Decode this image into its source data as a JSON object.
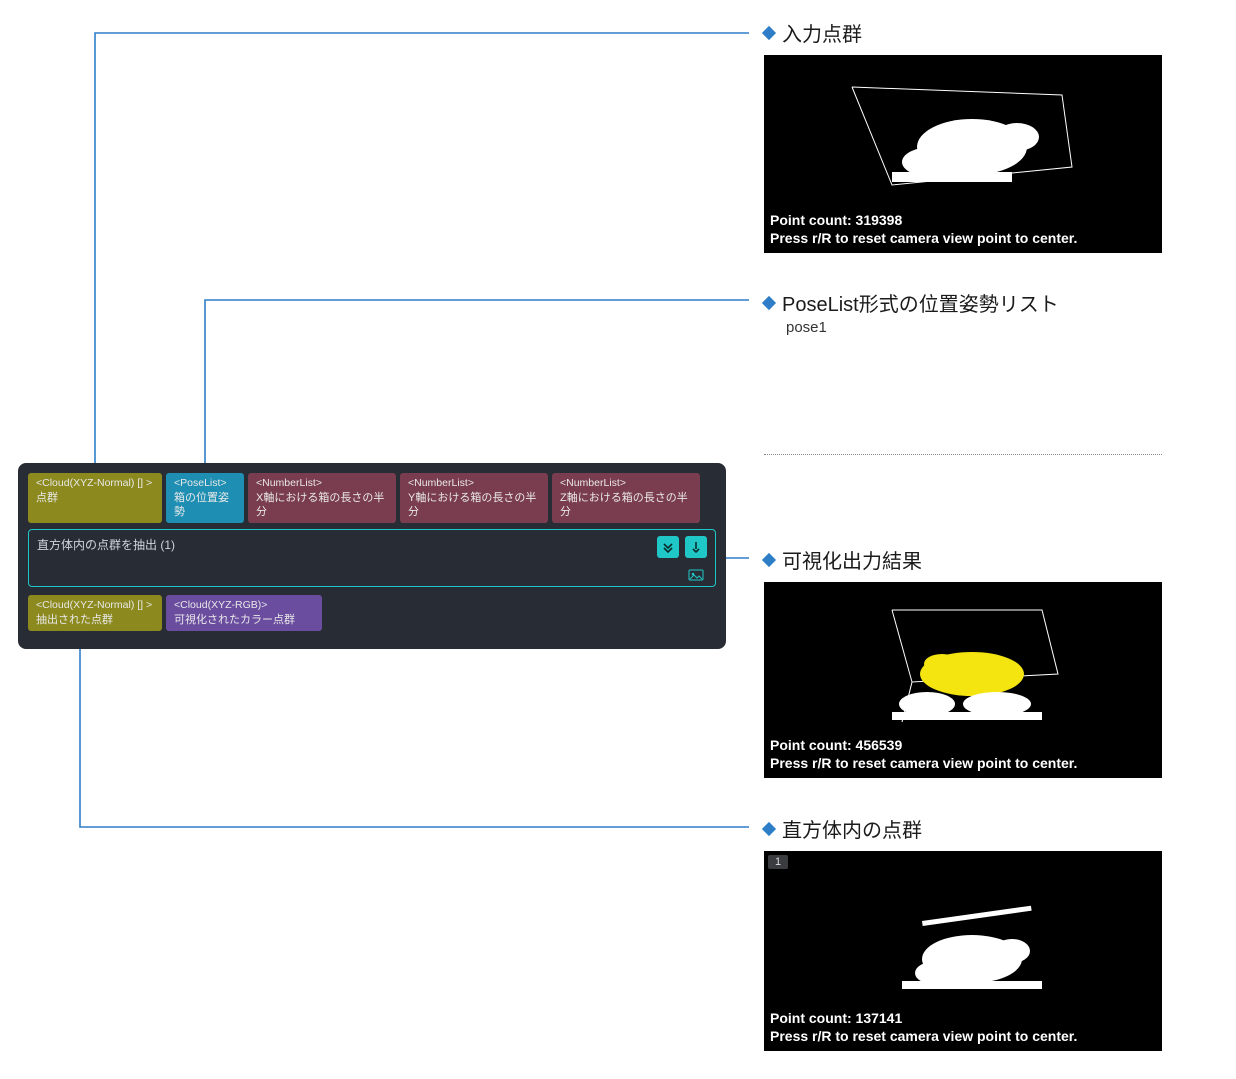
{
  "annotations": {
    "input_cloud": {
      "title": "入力点群"
    },
    "poselist": {
      "title": "PoseList形式の位置姿勢リスト",
      "sub": "pose1"
    },
    "vis_out": {
      "title": "可視化出力結果"
    },
    "box_cloud": {
      "title": "直方体内の点群"
    }
  },
  "node": {
    "title": "直方体内の点群を抽出 (1)",
    "inputs": [
      {
        "type": "<Cloud(XYZ-Normal) [] >",
        "label": "点群",
        "cls": "olive"
      },
      {
        "type": "<PoseList>",
        "label": "箱の位置姿勢",
        "cls": "teal"
      },
      {
        "type": "<NumberList>",
        "label": "X軸における箱の長さの半分",
        "cls": "maroon"
      },
      {
        "type": "<NumberList>",
        "label": "Y軸における箱の長さの半分",
        "cls": "maroon"
      },
      {
        "type": "<NumberList>",
        "label": "Z軸における箱の長さの半分",
        "cls": "maroon"
      }
    ],
    "outputs": [
      {
        "type": "<Cloud(XYZ-Normal) [] >",
        "label": "抽出された点群",
        "cls": "olive"
      },
      {
        "type": "<Cloud(XYZ-RGB)>",
        "label": "可視化されたカラー点群",
        "cls": "violet"
      }
    ]
  },
  "viewers": {
    "v1": {
      "point_count_label": "Point count: 319398",
      "hint": "Press r/R to reset camera view point to center."
    },
    "v2": {
      "point_count_label": "Point count: 456539",
      "hint": "Press r/R to reset camera view point to center."
    },
    "v3": {
      "tab": "1",
      "point_count_label": "Point count: 137141",
      "hint": "Press r/R to reset camera view point to center."
    }
  }
}
